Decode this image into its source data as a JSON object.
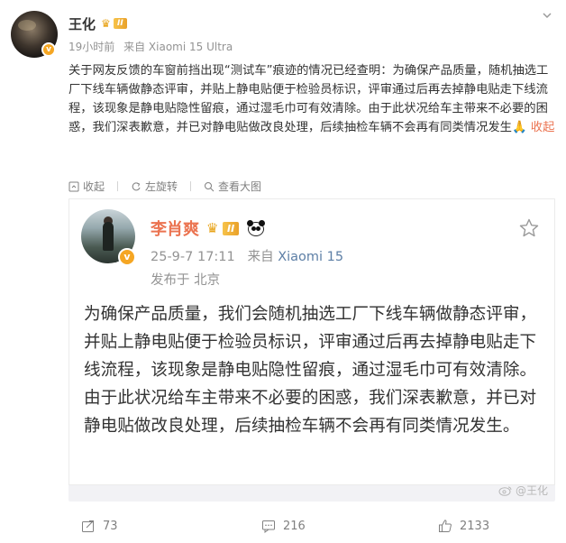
{
  "post": {
    "username": "王化",
    "vip_level": "II",
    "time": "19小时前",
    "source": "来自 Xiaomi 15 Ultra",
    "text": "关于网友反馈的车窗前挡出现“测试车”痕迹的情况已经查明：为确保产品质量，随机抽选工厂下线车辆做静态评审，并贴上静电贴便于检验员标识，评审通过后再去掉静电贴走下线流程，该现象是静电贴隐性留痕，通过湿毛巾可有效清除。由于此状况给车主带来不必要的困惑，我们深表歉意，并已对静电贴做改良处理，后续抽检车辆不会再有同类情况发生",
    "emoji": "🙏",
    "collapse_label": "收起"
  },
  "actions": {
    "collapse": "收起",
    "rotate": "左旋转",
    "view_large": "查看大图"
  },
  "repost": {
    "username": "李肖爽",
    "vip_level": "II",
    "datetime": "25-9-7 17:11",
    "source_prefix": "来自",
    "source_device": "Xiaomi 15",
    "location": "发布于 北京",
    "text": "为确保产品质量，我们会随机抽选工厂下线车辆做静态评审，并贴上静电贴便于检验员标识，评审通过后再去掉静电贴走下线流程，该现象是静电贴隐性留痕，通过湿毛巾可有效清除。由于此状况给车主带来不必要的困惑，我们深表歉意，并已对静电贴做改良处理，后续抽检车辆不会再有同类情况发生。",
    "watermark": "@王化"
  },
  "footer": {
    "reposts": "73",
    "comments": "216",
    "likes": "2133"
  },
  "colors": {
    "accent": "#eb7350",
    "link": "#5d7fa6",
    "meta": "#939393"
  }
}
